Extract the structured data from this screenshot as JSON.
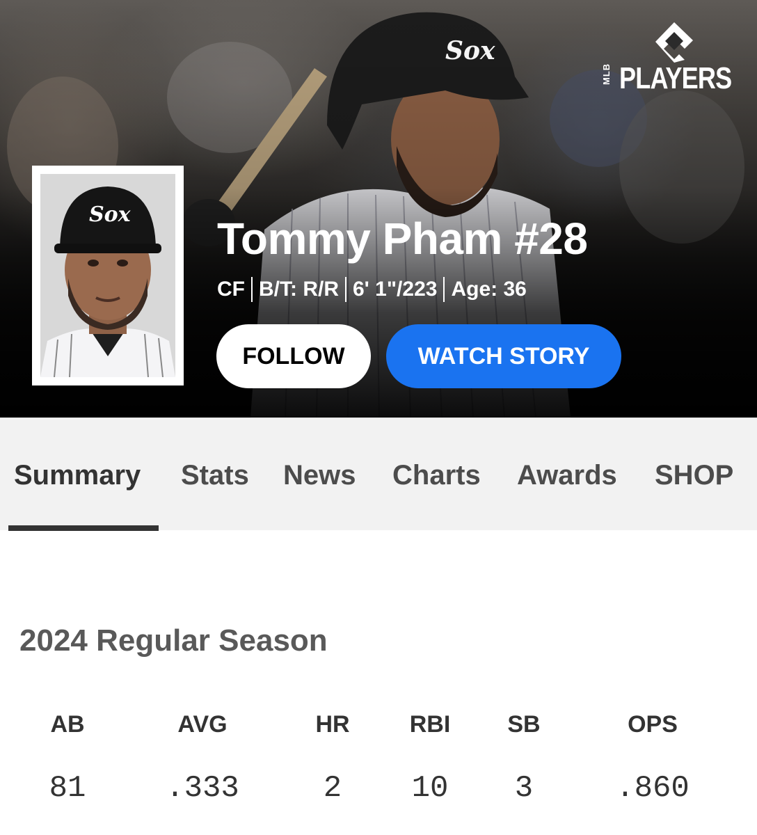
{
  "brand": {
    "league": "MLB",
    "name": "PLAYERS"
  },
  "player": {
    "name": "Tommy Pham #28",
    "position": "CF",
    "bats_throws": "B/T: R/R",
    "height_weight": "6' 1\"/223",
    "age": "Age: 36",
    "team_cap_logo": "Sox"
  },
  "actions": {
    "follow_label": "FOLLOW",
    "watch_label": "WATCH STORY"
  },
  "tabs": [
    {
      "label": "Summary",
      "active": true
    },
    {
      "label": "Stats"
    },
    {
      "label": "News"
    },
    {
      "label": "Charts"
    },
    {
      "label": "Awards"
    },
    {
      "label": "SHOP"
    }
  ],
  "season": {
    "title": "2024 Regular Season",
    "stats": [
      {
        "label": "AB",
        "value": "81"
      },
      {
        "label": "AVG",
        "value": ".333"
      },
      {
        "label": "HR",
        "value": "2"
      },
      {
        "label": "RBI",
        "value": "10"
      },
      {
        "label": "SB",
        "value": "3"
      },
      {
        "label": "OPS",
        "value": ".860"
      }
    ]
  },
  "colors": {
    "accent": "#1a73f0",
    "tab_text": "#4c4c4c",
    "tab_bar_bg": "#f2f2f2"
  }
}
